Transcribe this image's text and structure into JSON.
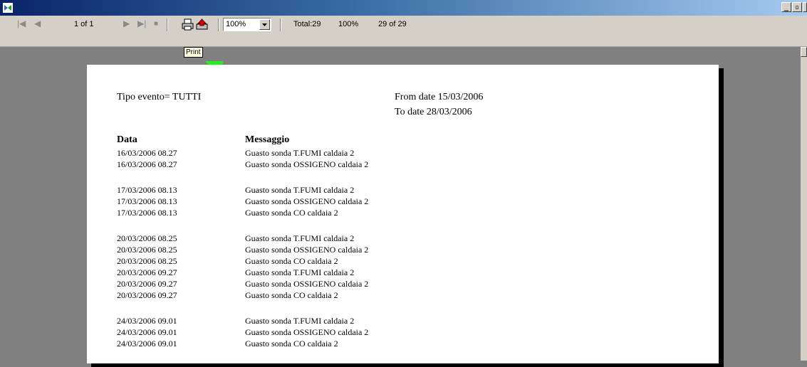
{
  "toolbar": {
    "page_indicator": "1 of 1",
    "zoom_value": "100%",
    "total": "Total:29",
    "percent": "100%",
    "records": "29 of 29"
  },
  "tooltip": "Print",
  "report": {
    "tipo_evento": "Tipo evento= TUTTI",
    "from_date": "From date 15/03/2006",
    "to_date": "To date  28/03/2006",
    "col_data": "Data",
    "col_messaggio": "Messaggio",
    "rows": [
      {
        "data": "16/03/2006 08.27",
        "msg": "Guasto sonda T.FUMI caldaia 2"
      },
      {
        "data": "16/03/2006 08.27",
        "msg": "Guasto sonda OSSIGENO caldaia 2"
      },
      {
        "data": "17/03/2006 08.13",
        "msg": "Guasto sonda T.FUMI caldaia 2"
      },
      {
        "data": "17/03/2006 08.13",
        "msg": "Guasto sonda OSSIGENO caldaia 2"
      },
      {
        "data": "17/03/2006 08.13",
        "msg": "Guasto sonda CO caldaia 2"
      },
      {
        "data": "20/03/2006 08.25",
        "msg": "Guasto sonda T.FUMI caldaia 2"
      },
      {
        "data": "20/03/2006 08.25",
        "msg": "Guasto sonda OSSIGENO caldaia 2"
      },
      {
        "data": "20/03/2006 08.25",
        "msg": "Guasto sonda CO caldaia 2"
      },
      {
        "data": "20/03/2006 09.27",
        "msg": "Guasto sonda T.FUMI caldaia 2"
      },
      {
        "data": "20/03/2006 09.27",
        "msg": "Guasto sonda OSSIGENO caldaia 2"
      },
      {
        "data": "20/03/2006 09.27",
        "msg": "Guasto sonda CO caldaia 2"
      },
      {
        "data": "24/03/2006 09.01",
        "msg": "Guasto sonda T.FUMI caldaia 2"
      },
      {
        "data": "24/03/2006 09.01",
        "msg": "Guasto sonda OSSIGENO caldaia 2"
      },
      {
        "data": "24/03/2006 09.01",
        "msg": "Guasto sonda CO caldaia 2"
      }
    ]
  },
  "colors": {
    "annotation_arrow": "#22ee22",
    "titlebar_start": "#0a246a",
    "titlebar_end": "#a6caf0"
  }
}
